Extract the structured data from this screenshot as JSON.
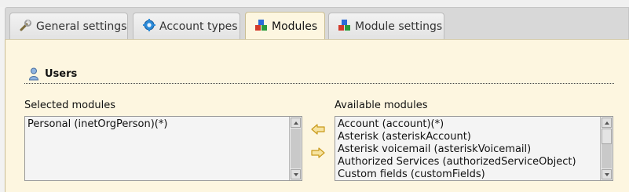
{
  "tabs": [
    {
      "label": "General settings",
      "icon": "wrench-icon"
    },
    {
      "label": "Account types",
      "icon": "gear-icon"
    },
    {
      "label": "Modules",
      "icon": "modules-icon",
      "active": true
    },
    {
      "label": "Module settings",
      "icon": "modules-icon"
    }
  ],
  "section": {
    "title": "Users",
    "icon": "user-icon"
  },
  "selected": {
    "label": "Selected modules",
    "items": [
      "Personal (inetOrgPerson)(*)"
    ]
  },
  "available": {
    "label": "Available modules",
    "items": [
      "Account (account)(*)",
      "Asterisk (asteriskAccount)",
      "Asterisk voicemail (asteriskVoicemail)",
      "Authorized Services (authorizedServiceObject)",
      "Custom fields (customFields)"
    ]
  },
  "colors": {
    "panel": "#fdf6e0",
    "arrow": "#e8b93a"
  }
}
